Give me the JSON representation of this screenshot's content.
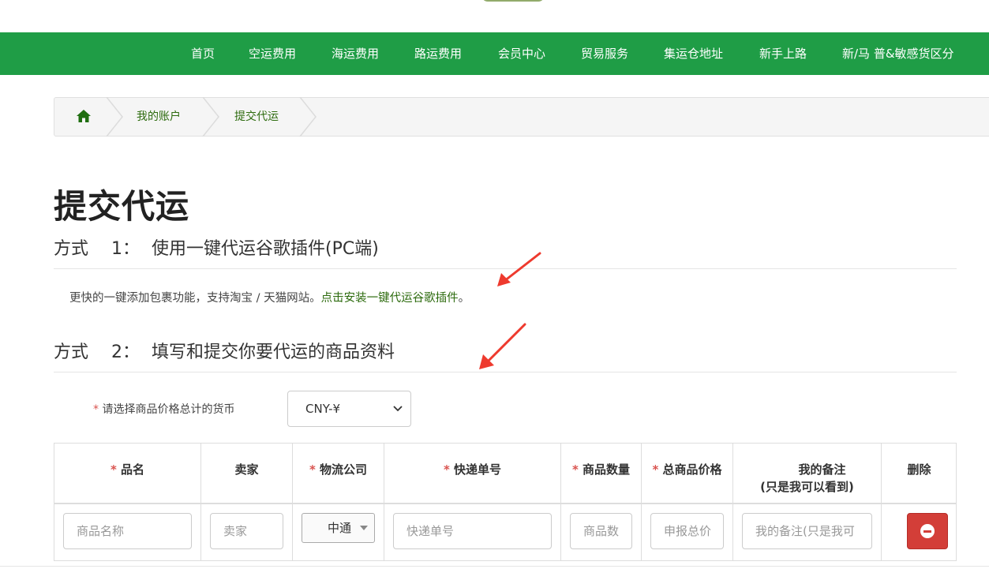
{
  "nav": {
    "items": [
      "首页",
      "空运费用",
      "海运费用",
      "路运费用",
      "会员中心",
      "贸易服务",
      "集运仓地址",
      "新手上路",
      "新/马 普&敏感货区分"
    ]
  },
  "breadcrumb": {
    "home_icon": "home-icon",
    "items": [
      "我的账户",
      "提交代运"
    ]
  },
  "page": {
    "title": "提交代运"
  },
  "method1": {
    "label": "方式",
    "num": "1：",
    "title": "使用一键代运谷歌插件(PC端)",
    "desc_text": "更快的一键添加包裹功能，支持淘宝 / 天猫网站。",
    "link_text": "点击安装一键代运谷歌插件",
    "desc_end": "。"
  },
  "method2": {
    "label": "方式",
    "num": "2：",
    "title": "填写和提交你要代运的商品资料"
  },
  "currency": {
    "required_mark": "*",
    "label": "请选择商品价格总计的货币",
    "selected": "CNY-¥"
  },
  "table": {
    "required_mark": "*",
    "headers": {
      "name": "品名",
      "seller": "卖家",
      "logistics": "物流公司",
      "tracking": "快递单号",
      "qty": "商品数量",
      "total": "总商品价格",
      "note_line1": "我的备注",
      "note_line2": "(只是我可以看到)",
      "delete": "删除"
    },
    "row": {
      "name_placeholder": "商品名称",
      "seller_placeholder": "卖家",
      "logistics_selected": "中通",
      "tracking_placeholder": "快递单号",
      "qty_placeholder": "商品数",
      "total_placeholder": "申报总价",
      "note_placeholder": "我的备注(只是我可"
    }
  },
  "colors": {
    "nav_bg": "#1f9d46",
    "link": "#2d6b0e",
    "danger": "#d33e38",
    "required": "#d9534f"
  }
}
